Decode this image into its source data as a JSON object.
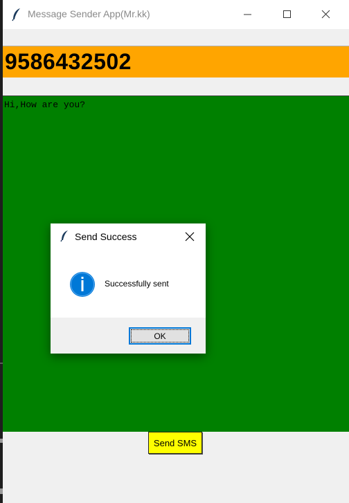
{
  "window": {
    "title": "Message Sender App(Mr.kk)"
  },
  "form": {
    "phone_number": "9586432502",
    "message": "Hi,How are you?",
    "send_label": "Send SMS"
  },
  "dialog": {
    "title": "Send Success",
    "message": "Successfully sent",
    "ok_label": "OK",
    "icon": "info-icon"
  },
  "colors": {
    "phone_bg": "#ffa500",
    "message_bg": "#008000",
    "send_button_bg": "#ffff00",
    "info_icon": "#0078d7"
  }
}
